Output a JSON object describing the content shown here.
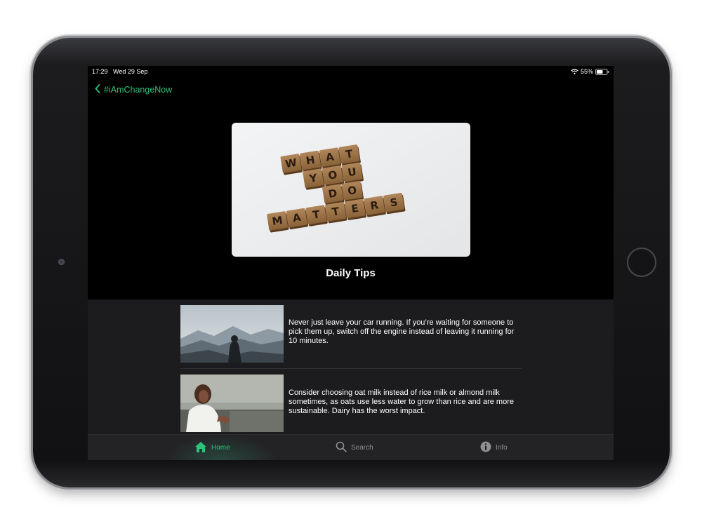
{
  "status_bar": {
    "time": "17:29",
    "date": "Wed 29 Sep",
    "battery": "55%"
  },
  "nav": {
    "back_label": "#iAmChangeNow",
    "back_icon": "chevron-left-icon"
  },
  "hero": {
    "image_words": [
      "WHAT",
      "YOU",
      "DO",
      "MATTERS"
    ]
  },
  "section_title": "Daily Tips",
  "tips": [
    {
      "text": "Never just leave your car running. If you’re waiting for someone to pick them up, switch off the engine instead of leaving it running for 10 minutes."
    },
    {
      "text": "Consider choosing oat milk instead of rice milk or almond milk sometimes, as oats use less water to grow than rice and are more sustainable. Dairy has the worst impact."
    }
  ],
  "tab_bar": {
    "tabs": [
      {
        "label": "Home",
        "icon": "home-icon",
        "active": true
      },
      {
        "label": "Search",
        "icon": "search-icon",
        "active": false
      },
      {
        "label": "Info",
        "icon": "info-icon",
        "active": false
      }
    ]
  },
  "colors": {
    "accent": "#2fc27a",
    "background": "#000000",
    "list_background": "#1c1c1e",
    "tab_bar": "#232326",
    "inactive_tab": "#8e8e93"
  }
}
